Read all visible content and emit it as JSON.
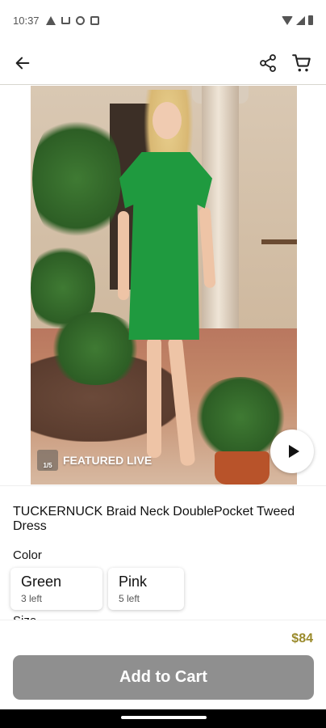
{
  "status_bar": {
    "time": "10:37",
    "left_icons": [
      "warning-icon",
      "cart-notification-icon",
      "shield-icon",
      "square-app-icon"
    ],
    "right_icons": [
      "wifi-icon",
      "signal-icon",
      "battery-icon"
    ]
  },
  "app_bar": {
    "back_icon": "arrow-left",
    "share_icon": "share",
    "cart_icon": "shopping-cart"
  },
  "media": {
    "featured_label": "FEATURED LIVE",
    "badge_text": "1/5",
    "play_icon": "play"
  },
  "product": {
    "title": "TUCKERNUCK Braid Neck DoublePocket Tweed Dress",
    "color_label": "Color",
    "colors": [
      {
        "name": "Green",
        "stock": "3 left"
      },
      {
        "name": "Pink",
        "stock": "5 left"
      }
    ],
    "size_label": "Size"
  },
  "footer": {
    "price": "$84",
    "add_to_cart_label": "Add to Cart"
  },
  "colors": {
    "dress_green": "#1f9a3f",
    "price_gold": "#9a8a2b",
    "button_gray": "#8f8f8f"
  }
}
